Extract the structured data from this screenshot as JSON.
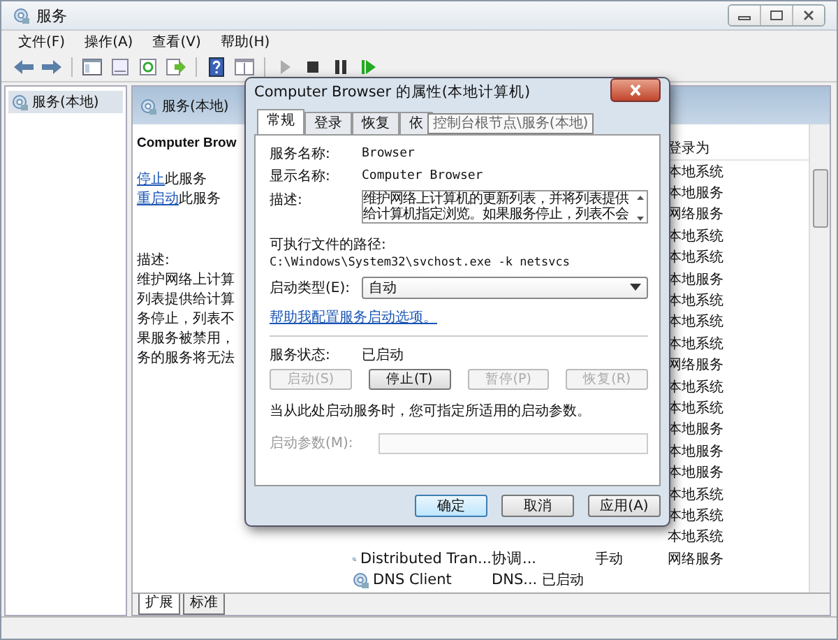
{
  "window": {
    "title": "服务"
  },
  "menu": [
    "文件(F)",
    "操作(A)",
    "查看(V)",
    "帮助(H)"
  ],
  "toolbar": [
    {
      "kind": "back",
      "disabled": false
    },
    {
      "kind": "forward",
      "disabled": false
    },
    {
      "kind": "separator"
    },
    {
      "kind": "tree",
      "disabled": false
    },
    {
      "kind": "sheet",
      "disabled": false
    },
    {
      "kind": "refresh",
      "disabled": false
    },
    {
      "kind": "export",
      "disabled": false
    },
    {
      "kind": "separator"
    },
    {
      "kind": "help",
      "disabled": false
    },
    {
      "kind": "view",
      "disabled": false
    },
    {
      "kind": "separator"
    },
    {
      "kind": "start",
      "disabled": true
    },
    {
      "kind": "stop",
      "disabled": false
    },
    {
      "kind": "pause",
      "disabled": false
    },
    {
      "kind": "restart",
      "disabled": false
    }
  ],
  "tree": {
    "items": [
      {
        "label": "服务(本地)",
        "selected": true
      }
    ]
  },
  "panel": {
    "header": "服务(本地)",
    "service_title": "Computer Brow",
    "actions": [
      {
        "link": "停止",
        "rest": "此服务"
      },
      {
        "link": "重启动",
        "rest": "此服务"
      }
    ],
    "description_label": "描述:",
    "description_lines": [
      "维护网络上计算",
      "列表提供给计算",
      "务停止，列表不",
      "果服务被禁用，",
      "务的服务将无法"
    ]
  },
  "list": {
    "columns": [
      "登录为"
    ],
    "rows": [
      {
        "logon": "本地系统"
      },
      {
        "logon": "本地服务"
      },
      {
        "logon": "网络服务"
      },
      {
        "logon": "本地系统"
      },
      {
        "logon": "本地系统"
      },
      {
        "logon": "本地服务"
      },
      {
        "logon": "本地系统"
      },
      {
        "logon": "本地系统"
      },
      {
        "logon": "本地系统"
      },
      {
        "logon": "网络服务"
      },
      {
        "logon": "本地系统"
      },
      {
        "logon": "本地系统"
      },
      {
        "logon": "本地服务"
      },
      {
        "logon": "本地服务"
      },
      {
        "logon": "本地服务"
      },
      {
        "logon": "本地系统"
      },
      {
        "logon": "本地系统"
      },
      {
        "logon": "本地系统"
      },
      {
        "name": "Distributed Tran...",
        "description": "协调...",
        "startup": "手动",
        "logon": "网络服务"
      },
      {
        "name": "DNS Client",
        "description": "DNS...",
        "status": "已启动"
      }
    ]
  },
  "view_tabs": [
    {
      "label": "扩展",
      "selected": true
    },
    {
      "label": "标准",
      "selected": false
    }
  ],
  "dialog": {
    "title": "Computer Browser 的属性(本地计算机)",
    "tabs": [
      {
        "label": "常规",
        "selected": true
      },
      {
        "label": "登录",
        "selected": false
      },
      {
        "label": "恢复",
        "selected": false
      },
      {
        "label": "依",
        "selected": false
      }
    ],
    "tooltip": "控制台根节点\\服务(本地)",
    "fields": [
      {
        "label": "服务名称:",
        "value": "Browser"
      },
      {
        "label": "显示名称:",
        "value": "Computer Browser"
      }
    ],
    "description_label": "描述:",
    "description": "维护网络上计算机的更新列表，并将列表提供给计算机指定浏览。如果服务停止，列表不会",
    "path_label": "可执行文件的路径:",
    "path": "C:\\Windows\\System32\\svchost.exe -k netsvcs",
    "startup_label": "启动类型(E):",
    "startup_value": "自动",
    "help_link": "帮助我配置服务启动选项。",
    "status_label": "服务状态:",
    "status_value": "已启动",
    "service_buttons": [
      {
        "label": "启动(S)",
        "disabled": true
      },
      {
        "label": "停止(T)",
        "disabled": false
      },
      {
        "label": "暂停(P)",
        "disabled": true
      },
      {
        "label": "恢复(R)",
        "disabled": true
      }
    ],
    "hint": "当从此处启动服务时，您可指定所适用的启动参数。",
    "params_label": "启动参数(M):",
    "params_disabled": true,
    "buttons": [
      {
        "label": "确定",
        "default": true
      },
      {
        "label": "取消",
        "default": false
      },
      {
        "label": "应用(A)",
        "default": false
      }
    ]
  }
}
